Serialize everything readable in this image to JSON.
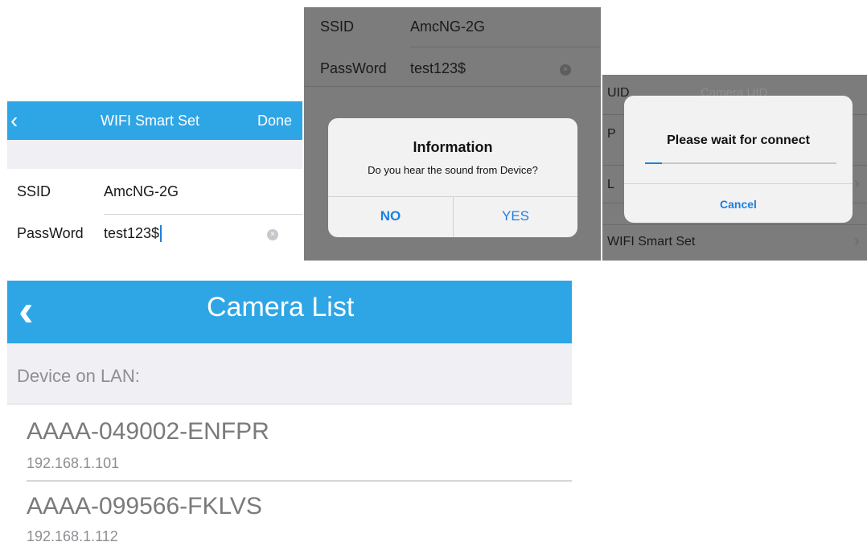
{
  "wifi_panel": {
    "title": "WIFI Smart Set",
    "back_glyph": "‹",
    "done_label": "Done",
    "ssid_label": "SSID",
    "ssid_value": "AmcNG-2G",
    "password_label": "PassWord",
    "password_value": "test123$",
    "clear_glyph": "×"
  },
  "info_panel": {
    "ssid_label": "SSID",
    "ssid_value": "AmcNG-2G",
    "password_label": "PassWord",
    "password_value": "test123$",
    "clear_glyph": "×",
    "alert": {
      "title": "Information",
      "message": "Do you hear the sound from Device?",
      "no_label": "NO",
      "yes_label": "YES"
    }
  },
  "wait_panel": {
    "uid_label": "UID",
    "uid_value": "Camera UID",
    "row2_label": "P",
    "row3_label": "L",
    "wifi_row_label": "WIFI Smart Set",
    "chevron_glyph": "›",
    "alert": {
      "title": "Please wait for connect",
      "cancel_label": "Cancel",
      "progress": 0.09
    }
  },
  "camera_list": {
    "title": "Camera List",
    "back_glyph": "‹",
    "section_label": "Device on LAN:",
    "devices": [
      {
        "name": "AAAA-049002-ENFPR",
        "ip": "192.168.1.101"
      },
      {
        "name": "AAAA-099566-FKLVS",
        "ip": "192.168.1.112"
      }
    ]
  },
  "colors": {
    "nav_blue": "#2ea6e6",
    "action_blue": "#1e7fe0",
    "dim_gray": "#7c7c7c"
  }
}
